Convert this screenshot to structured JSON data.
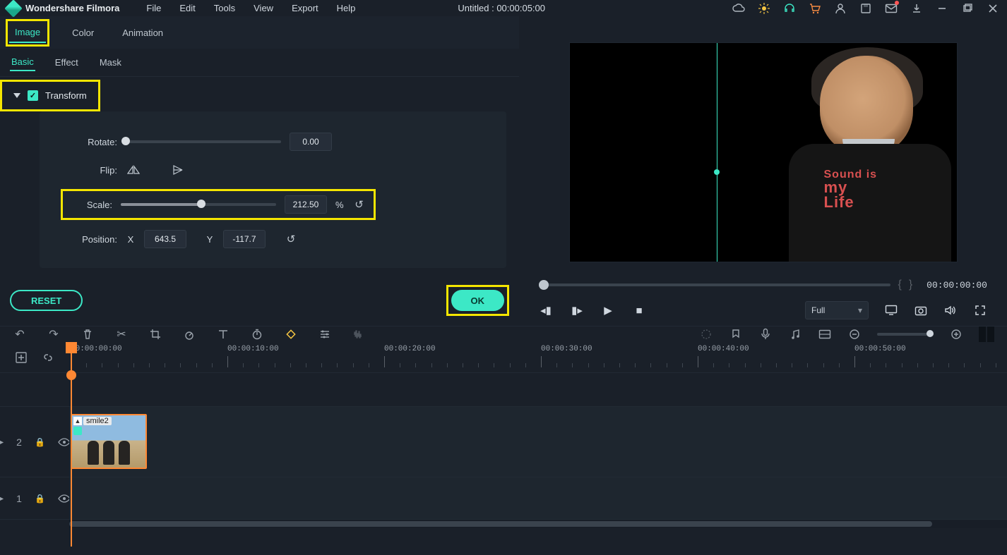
{
  "app": {
    "name": "Wondershare Filmora",
    "doc_title": "Untitled : 00:00:05:00"
  },
  "menu": [
    "File",
    "Edit",
    "Tools",
    "View",
    "Export",
    "Help"
  ],
  "panel_top_tabs": [
    "Image",
    "Color",
    "Animation"
  ],
  "panel_sub_tabs": [
    "Basic",
    "Effect",
    "Mask"
  ],
  "transform": {
    "title": "Transform",
    "rotate_label": "Rotate:",
    "rotate_value": "0.00",
    "flip_label": "Flip:",
    "scale_label": "Scale:",
    "scale_value": "212.50",
    "scale_unit": "%",
    "position_label": "Position:",
    "x_label": "X",
    "x_value": "643.5",
    "y_label": "Y",
    "y_value": "-117.7"
  },
  "buttons": {
    "reset": "RESET",
    "ok": "OK"
  },
  "preview": {
    "timecode": "00:00:00:00",
    "quality": "Full",
    "shirt_l1": "Sound is",
    "shirt_l2": "my",
    "shirt_l3": "Life"
  },
  "ruler": [
    "00:00:00:00",
    "00:00:10:00",
    "00:00:20:00",
    "00:00:30:00",
    "00:00:40:00",
    "00:00:50:00"
  ],
  "tracks": {
    "t2": "2",
    "t1": "1"
  },
  "clip": {
    "name": "smile2"
  }
}
